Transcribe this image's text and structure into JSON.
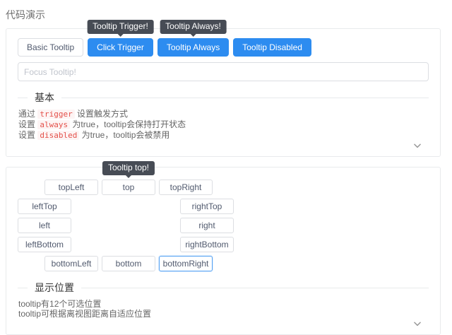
{
  "page": {
    "title": "代码演示"
  },
  "colors": {
    "primary": "#2d8cf0",
    "tooltip_bg": "rgba(61,66,76,0.95)",
    "card_border": "#e8eaec",
    "button_border": "#dcdee2",
    "code_text": "#e4504a",
    "focused_border": "#57a3f3"
  },
  "icons": {
    "expand": "chevron-down-icon"
  },
  "card1": {
    "tooltips": {
      "trigger": "Tooltip Trigger!",
      "always": "Tooltip Always!"
    },
    "buttons": {
      "basic": "Basic Tooltip",
      "click": "Click Trigger",
      "always": "Tooltip Always",
      "disabled": "Tooltip Disabled"
    },
    "input_placeholder": "Focus Tooltip!",
    "section_title": "基本",
    "lines": [
      {
        "pre": "通过 ",
        "code": "trigger",
        "post": " 设置触发方式"
      },
      {
        "pre": "设置 ",
        "code": "always",
        "post": " 为true，tooltip会保持打开状态"
      },
      {
        "pre": "设置 ",
        "code": "disabled",
        "post": " 为true，tooltip会被禁用"
      }
    ]
  },
  "card2": {
    "tooltip_top": "Tooltip top!",
    "buttons": {
      "top_left": "topLeft",
      "top": "top",
      "top_right": "topRight",
      "left_top": "leftTop",
      "right_top": "rightTop",
      "left": "left",
      "right": "right",
      "left_bottom": "leftBottom",
      "right_bottom": "rightBottom",
      "bottom_left": "bottomLeft",
      "bottom": "bottom",
      "bottom_right": "bottomRight"
    },
    "section_title": "显示位置",
    "lines": [
      "tooltip有12个可选位置",
      "tooltip可根据离视图距离自适应位置"
    ]
  }
}
